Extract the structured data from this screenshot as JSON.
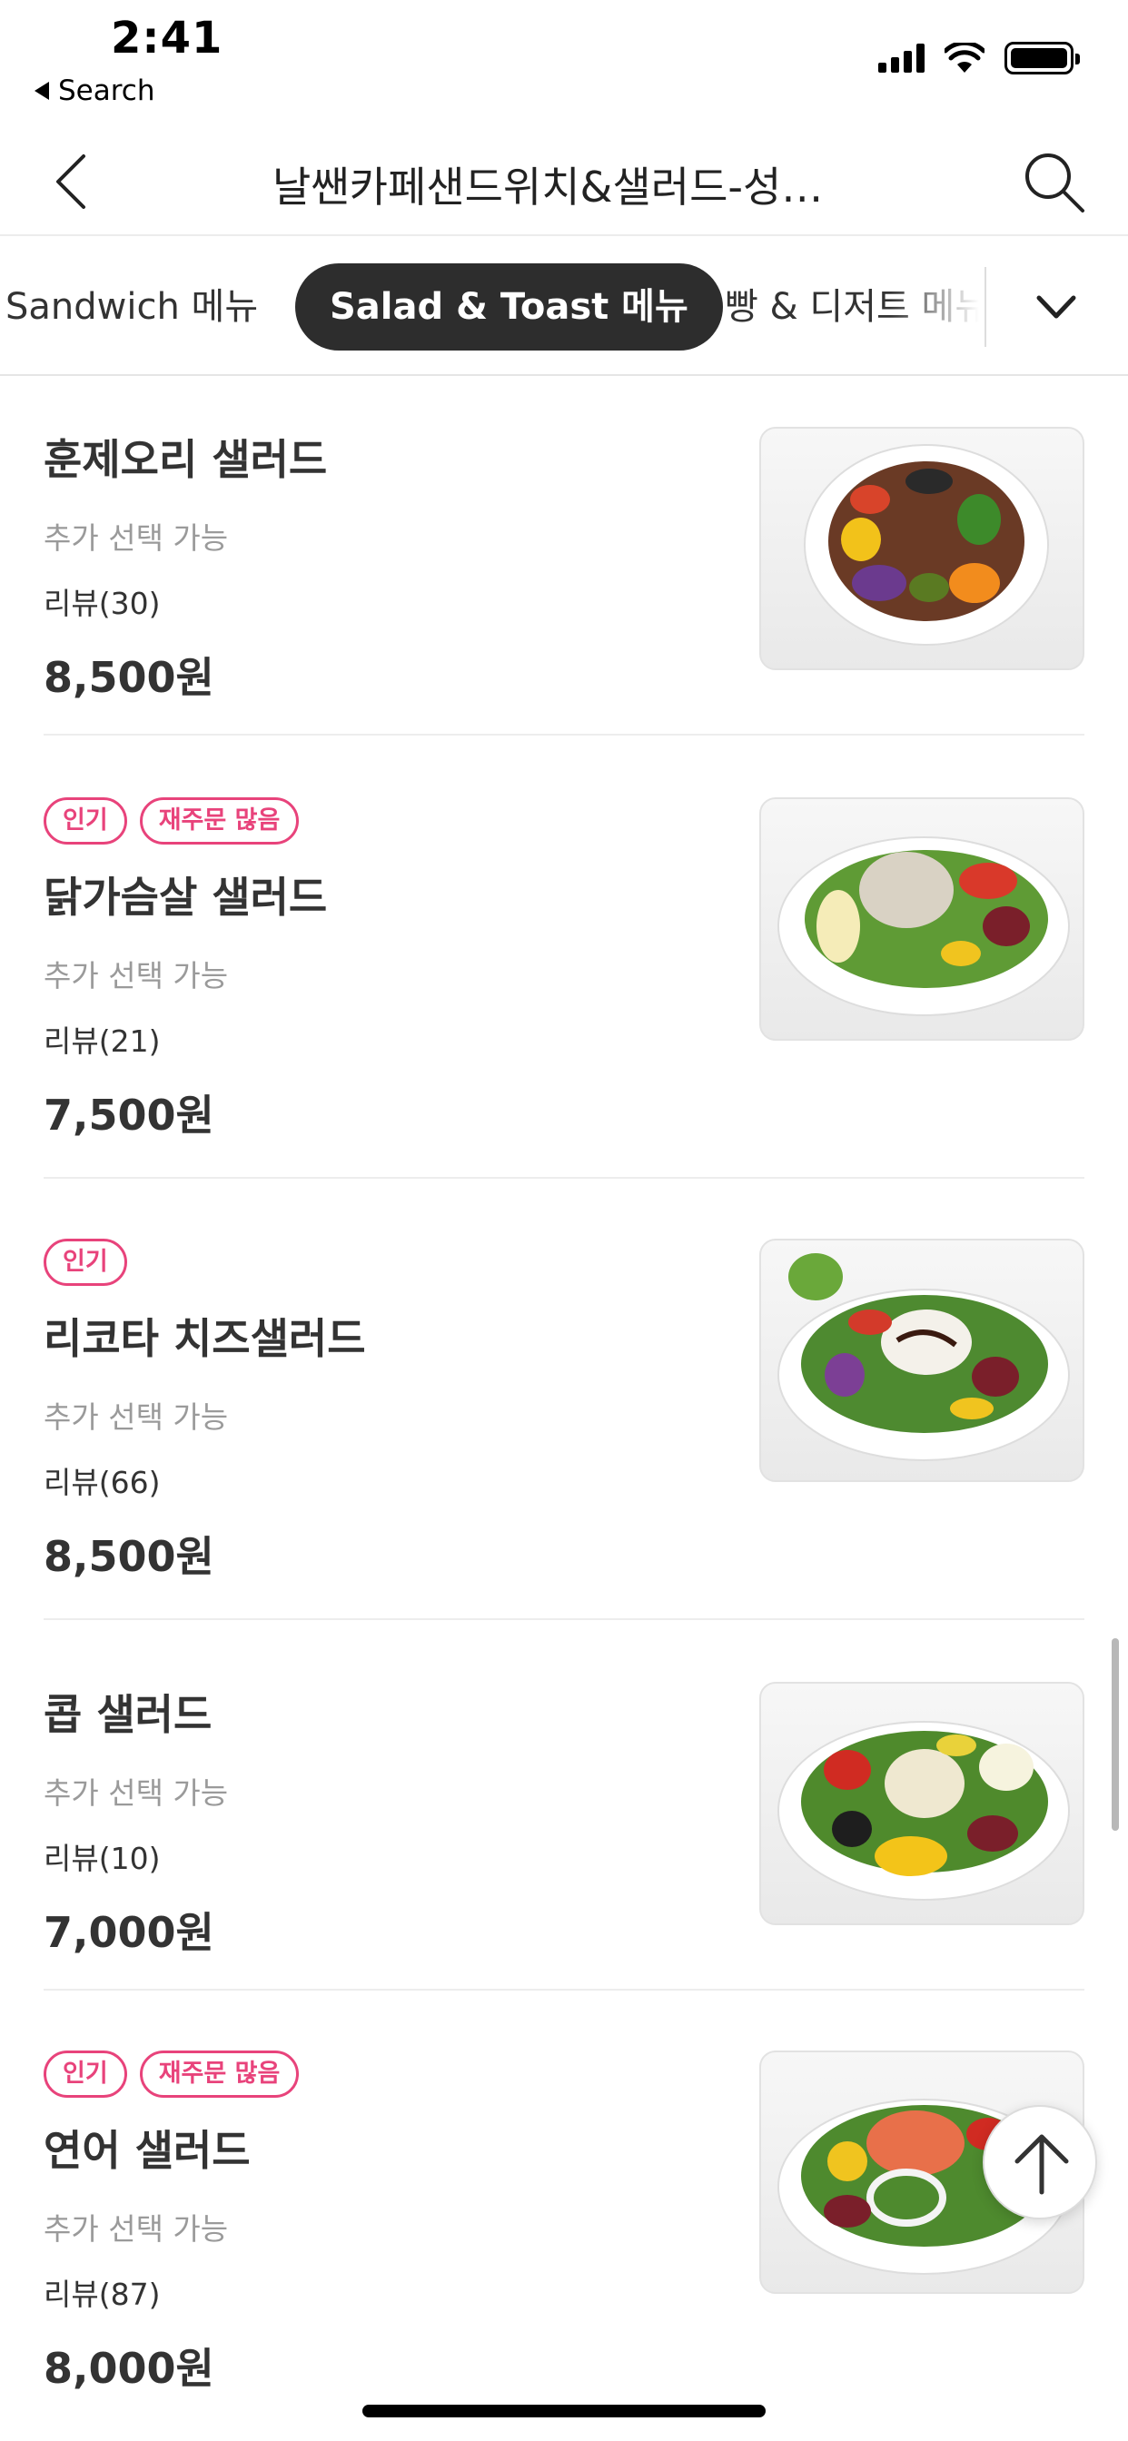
{
  "status_bar": {
    "time": "2:41",
    "back_app_label": "Search"
  },
  "nav": {
    "title": "날쌘카페샌드위치&샐러드-성…",
    "back_icon": "chevron-left-icon",
    "search_icon": "search-icon"
  },
  "tabs": {
    "items": [
      {
        "label": "Sandwich 메뉴",
        "selected": false
      },
      {
        "label": "Salad & Toast 메뉴",
        "selected": true
      },
      {
        "label": "빵 & 디저트 메뉴",
        "selected": false
      }
    ],
    "more_icon": "chevron-down-icon"
  },
  "menu": [
    {
      "badges": [],
      "name": "훈제오리 샐러드",
      "option": "추가 선택 가능",
      "review": "리뷰(30)",
      "price": "8,500원"
    },
    {
      "badges": [
        "인기",
        "재주문 많음"
      ],
      "name": "닭가슴살 샐러드",
      "option": "추가 선택 가능",
      "review": "리뷰(21)",
      "price": "7,500원"
    },
    {
      "badges": [
        "인기"
      ],
      "name": "리코타 치즈샐러드",
      "option": "추가 선택 가능",
      "review": "리뷰(66)",
      "price": "8,500원"
    },
    {
      "badges": [],
      "name": "콥 샐러드",
      "option": "추가 선택 가능",
      "review": "리뷰(10)",
      "price": "7,000원"
    },
    {
      "badges": [
        "인기",
        "재주문 많음"
      ],
      "name": "연어 샐러드",
      "option": "추가 선택 가능",
      "review": "리뷰(87)",
      "price": "8,000원"
    }
  ],
  "colors": {
    "badge": "#e8437b",
    "selected_tab_bg": "#2d2d2d"
  },
  "fab": {
    "icon": "arrow-up-icon"
  }
}
